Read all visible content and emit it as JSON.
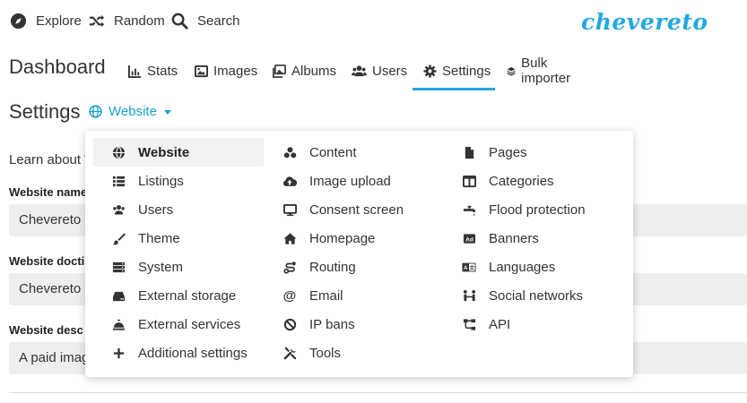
{
  "topnav": {
    "explore": "Explore",
    "random": "Random",
    "search": "Search",
    "logo": "chevereto"
  },
  "dashboard": {
    "title": "Dashboard",
    "tabs": [
      {
        "label": "Stats",
        "icon": "chart-icon"
      },
      {
        "label": "Images",
        "icon": "image-icon"
      },
      {
        "label": "Albums",
        "icon": "images-icon"
      },
      {
        "label": "Users",
        "icon": "users-icon"
      },
      {
        "label": "Settings",
        "icon": "gear-icon",
        "active": true
      },
      {
        "label": "Bulk importer",
        "icon": "layers-icon"
      }
    ]
  },
  "settings": {
    "title": "Settings",
    "section_select": "Website",
    "learn_text": "Learn about W",
    "fields": [
      {
        "label": "Website name",
        "value": "Chevereto"
      },
      {
        "label": "Website docti",
        "value": "Chevereto in"
      },
      {
        "label": "Website desc",
        "value": "A paid imag"
      }
    ]
  },
  "dropdown": {
    "col1": [
      "Website",
      "Listings",
      "Users",
      "Theme",
      "System",
      "External storage",
      "External services",
      "Additional settings"
    ],
    "col2": [
      "Content",
      "Image upload",
      "Consent screen",
      "Homepage",
      "Routing",
      "Email",
      "IP bans",
      "Tools"
    ],
    "col3": [
      "Pages",
      "Categories",
      "Flood protection",
      "Banners",
      "Languages",
      "Social networks",
      "API"
    ],
    "active": "Website"
  },
  "colors": {
    "accent": "#23a8e0",
    "link": "#1b9fd6",
    "field_bg": "#eeeeee"
  }
}
